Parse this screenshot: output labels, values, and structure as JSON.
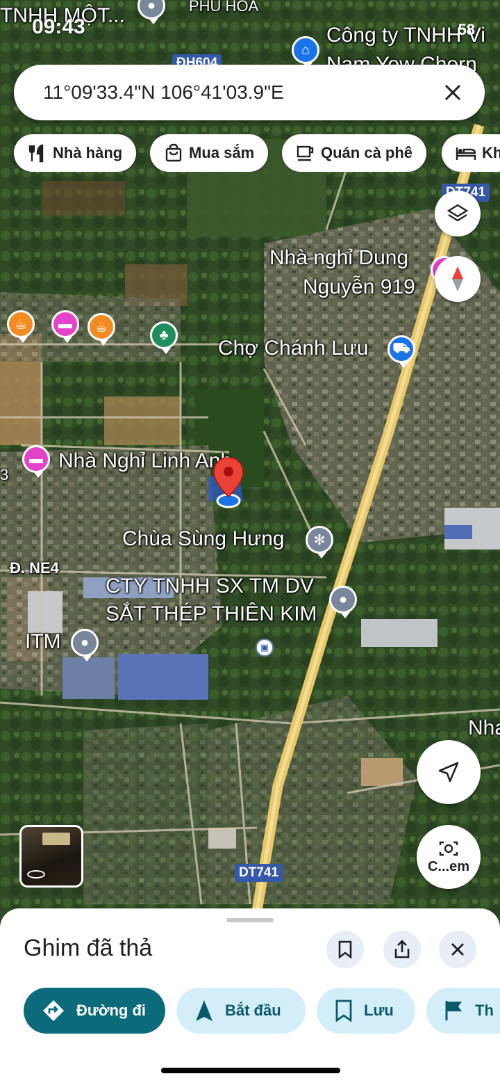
{
  "status_bar": {
    "time": "09:43",
    "right_text": "58"
  },
  "search": {
    "text": "11°09'33.4\"N 106°41'03.9\"E"
  },
  "chips": [
    {
      "label": "Nhà hàng",
      "icon": "restaurant-icon"
    },
    {
      "label": "Mua sắm",
      "icon": "shopping-bag-icon"
    },
    {
      "label": "Quán cà phê",
      "icon": "coffee-icon"
    },
    {
      "label": "Kh",
      "icon": "hotel-bed-icon"
    }
  ],
  "map": {
    "labels": {
      "top_company": "TNHH MỘT...",
      "phu_hoa": "PHÚ HÒA",
      "cong_ty": "Công ty TNHH Vi",
      "nam_yow": "Nam Yow Chorn",
      "nha_nghi_dung_1": "Nhà nghỉ Dung",
      "nha_nghi_dung_2": "Nguyễn 919",
      "cho_chanh_luu": "Chợ Chánh Lưu",
      "nha_nghi_linh_anh": "Nhà Nghỉ Linh Anh",
      "chua_sung_hung": "Chùa Sùng Hưng",
      "cty_1": "CTY TNHH SX TM DV",
      "cty_2": "SẮT THÉP THIÊN KIM",
      "itm": "ITM",
      "ne4": "Đ. NE4",
      "nha_right": "Nha",
      "edge_3": "3"
    },
    "shields": {
      "dh604": "ĐH604",
      "dt741_top": "DT741",
      "dt741_bottom": "DT741"
    },
    "camera_label": "C...em"
  },
  "sheet": {
    "title": "Ghim đã thả",
    "actions": [
      {
        "label": "Đường đi",
        "icon": "directions-icon"
      },
      {
        "label": "Bắt đầu",
        "icon": "navigation-arrow-icon"
      },
      {
        "label": "Lưu",
        "icon": "bookmark-icon"
      },
      {
        "label": "Th",
        "icon": "flag-icon"
      }
    ]
  },
  "colors": {
    "primary": "#0b6b7a",
    "accent_light": "#d3eef8",
    "pin_red": "#ea4335",
    "road_yellow": "#e9c869"
  }
}
